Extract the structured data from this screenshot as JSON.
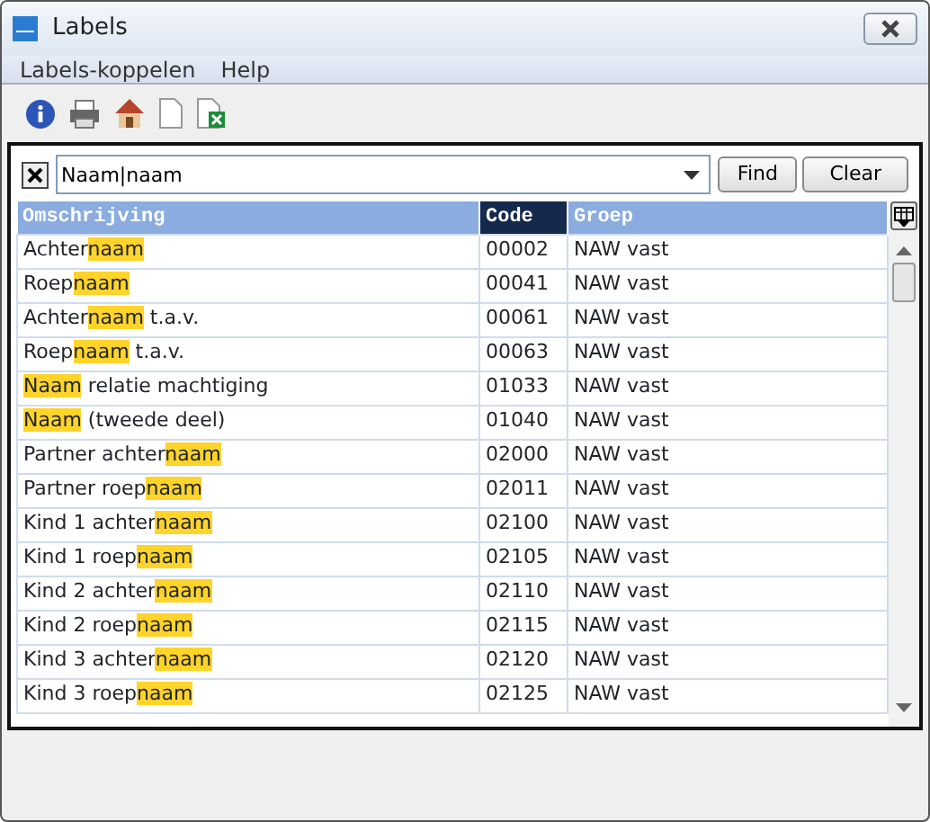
{
  "window": {
    "title": "Labels"
  },
  "menu": [
    "Labels-koppelen",
    "Help"
  ],
  "search": {
    "clear_filter": {
      "checked": true
    },
    "value": "Naam|naam",
    "buttons": [
      "Find",
      "Clear"
    ]
  },
  "table": {
    "columns": [
      {
        "label": "Omschrijving",
        "selected": false
      },
      {
        "label": "Code",
        "selected": true
      },
      {
        "label": "Groep",
        "selected": false
      }
    ],
    "rows": [
      {
        "description": [
          {
            "text": "Achter",
            "highlighted": false
          },
          {
            "text": "naam",
            "highlighted": true
          }
        ],
        "code": "00002",
        "group": "NAW vast"
      },
      {
        "description": [
          {
            "text": "Roep",
            "highlighted": false
          },
          {
            "text": "naam",
            "highlighted": true
          }
        ],
        "code": "00041",
        "group": "NAW vast"
      },
      {
        "description": [
          {
            "text": "Achter",
            "highlighted": false
          },
          {
            "text": "naam",
            "highlighted": true
          },
          {
            "text": " t.a.v.",
            "highlighted": false
          }
        ],
        "code": "00061",
        "group": "NAW vast"
      },
      {
        "description": [
          {
            "text": "Roep",
            "highlighted": false
          },
          {
            "text": "naam",
            "highlighted": true
          },
          {
            "text": " t.a.v.",
            "highlighted": false
          }
        ],
        "code": "00063",
        "group": "NAW vast"
      },
      {
        "description": [
          {
            "text": "Naam",
            "highlighted": true
          },
          {
            "text": " relatie machtiging",
            "highlighted": false
          }
        ],
        "code": "01033",
        "group": "NAW vast"
      },
      {
        "description": [
          {
            "text": "Naam",
            "highlighted": true
          },
          {
            "text": " (tweede deel)",
            "highlighted": false
          }
        ],
        "code": "01040",
        "group": "NAW vast"
      },
      {
        "description": [
          {
            "text": "Partner achter",
            "highlighted": false
          },
          {
            "text": "naam",
            "highlighted": true
          }
        ],
        "code": "02000",
        "group": "NAW vast"
      },
      {
        "description": [
          {
            "text": "Partner roep",
            "highlighted": false
          },
          {
            "text": "naam",
            "highlighted": true
          }
        ],
        "code": "02011",
        "group": "NAW vast"
      },
      {
        "description": [
          {
            "text": "Kind 1 achter",
            "highlighted": false
          },
          {
            "text": "naam",
            "highlighted": true
          }
        ],
        "code": "02100",
        "group": "NAW vast"
      },
      {
        "description": [
          {
            "text": "Kind 1 roep",
            "highlighted": false
          },
          {
            "text": "naam",
            "highlighted": true
          }
        ],
        "code": "02105",
        "group": "NAW vast"
      },
      {
        "description": [
          {
            "text": "Kind 2 achter",
            "highlighted": false
          },
          {
            "text": "naam",
            "highlighted": true
          }
        ],
        "code": "02110",
        "group": "NAW vast"
      },
      {
        "description": [
          {
            "text": "Kind 2 roep",
            "highlighted": false
          },
          {
            "text": "naam",
            "highlighted": true
          }
        ],
        "code": "02115",
        "group": "NAW vast"
      },
      {
        "description": [
          {
            "text": "Kind 3 achter",
            "highlighted": false
          },
          {
            "text": "naam",
            "highlighted": true
          }
        ],
        "code": "02120",
        "group": "NAW vast"
      },
      {
        "description": [
          {
            "text": "Kind 3 roep",
            "highlighted": false
          },
          {
            "text": "naam",
            "highlighted": true
          }
        ],
        "code": "02125",
        "group": "NAW vast"
      }
    ]
  }
}
